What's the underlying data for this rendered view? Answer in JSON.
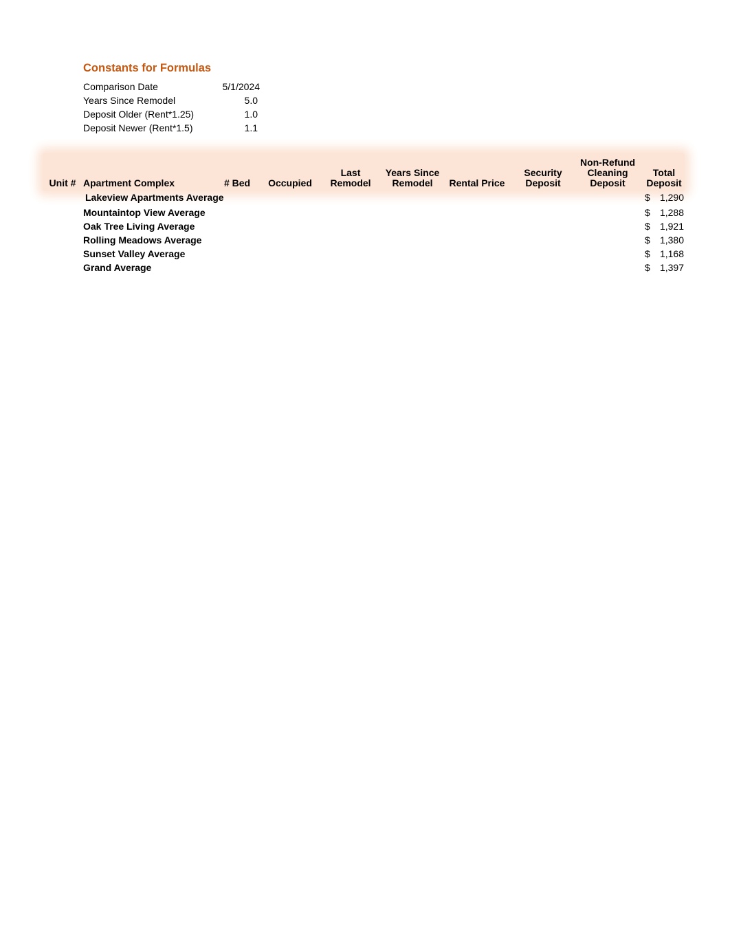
{
  "constants": {
    "title": "Constants for Formulas",
    "rows": [
      {
        "label": "Comparison Date",
        "value": "5/1/2024"
      },
      {
        "label": "Years Since Remodel",
        "value": "5.0"
      },
      {
        "label": "Deposit Older (Rent*1.25)",
        "value": "1.0"
      },
      {
        "label": "Deposit Newer (Rent*1.5)",
        "value": "1.1"
      }
    ]
  },
  "table": {
    "headers": {
      "unit": [
        "Unit #"
      ],
      "complex": [
        "Apartment Complex"
      ],
      "bed": [
        "# Bed"
      ],
      "occupied": [
        "Occupied"
      ],
      "last_remodel": [
        "Last",
        "Remodel"
      ],
      "years_since": [
        "Years Since",
        "Remodel"
      ],
      "rental_price": [
        "Rental Price"
      ],
      "security_deposit": [
        "Security",
        "Deposit"
      ],
      "cleaning_deposit": [
        "Non-Refund",
        "Cleaning",
        "Deposit"
      ],
      "total_deposit": [
        "Total",
        "Deposit"
      ]
    },
    "summary_rows": [
      {
        "label": "Lakeview Apartments Average",
        "currency": "$",
        "total_deposit": "1,290"
      },
      {
        "label": "Mountaintop View Average",
        "currency": "$",
        "total_deposit": "1,288"
      },
      {
        "label": "Oak Tree Living Average",
        "currency": "$",
        "total_deposit": "1,921"
      },
      {
        "label": "Rolling Meadows Average",
        "currency": "$",
        "total_deposit": "1,380"
      },
      {
        "label": "Sunset Valley Average",
        "currency": "$",
        "total_deposit": "1,168"
      },
      {
        "label": "Grand Average",
        "currency": "$",
        "total_deposit": "1,397"
      }
    ]
  },
  "colors": {
    "title_accent": "#C65911",
    "header_fill": "#FCE4D6"
  }
}
